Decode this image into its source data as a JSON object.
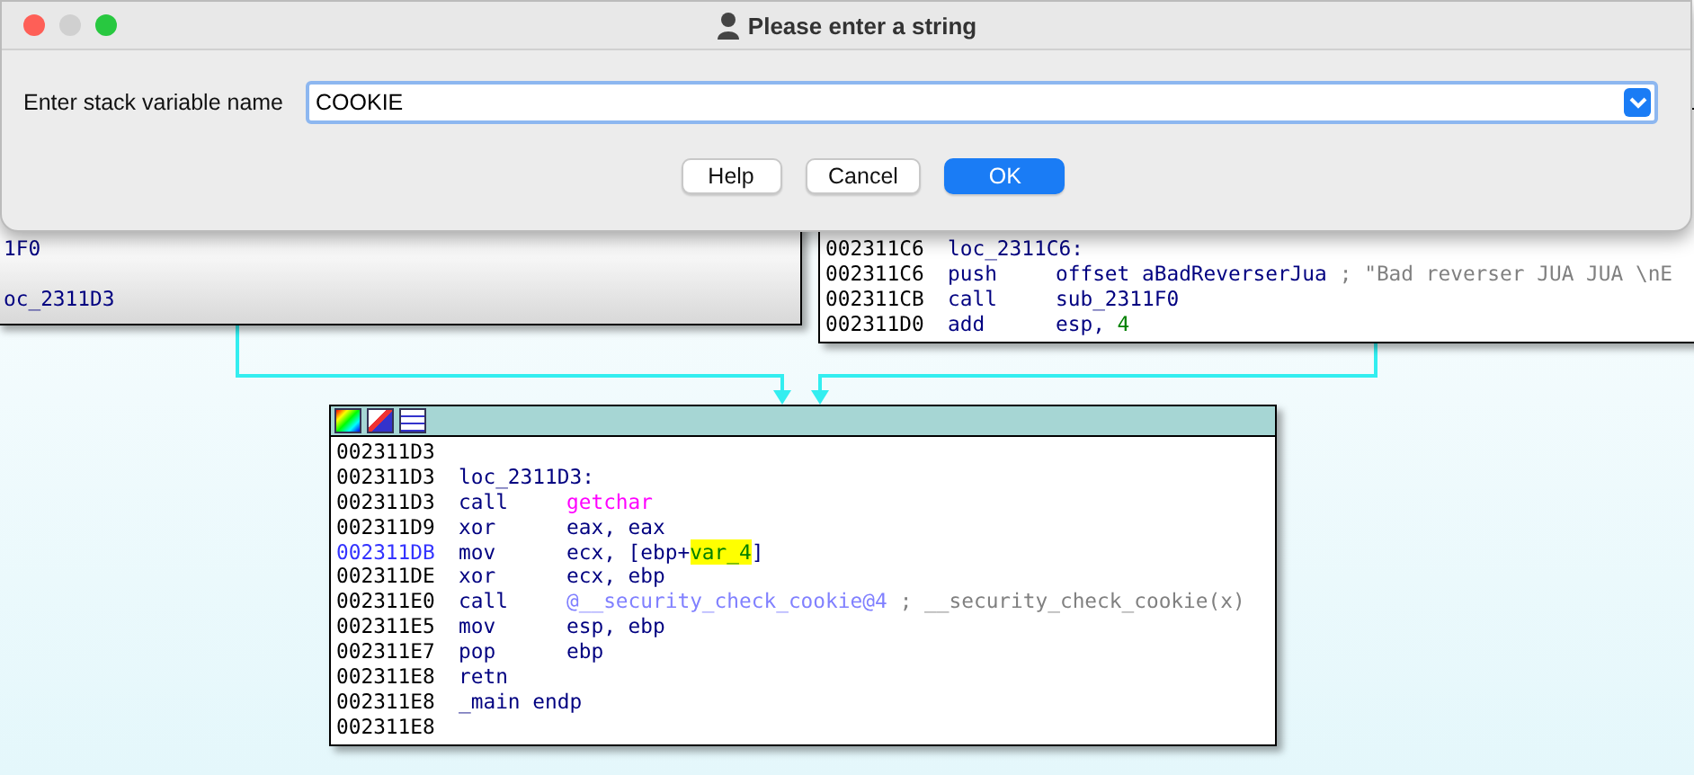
{
  "dialog": {
    "title": "Please enter a string",
    "field_label": "Enter stack variable name",
    "field_value": "COOKIE",
    "buttons": [
      {
        "label": "Help",
        "kind": "plain"
      },
      {
        "label": "Cancel",
        "kind": "plain"
      },
      {
        "label": "OK",
        "kind": "default"
      }
    ]
  },
  "graph": {
    "nodes": [
      {
        "kind": "partial-left",
        "header": false,
        "lines": [
          {
            "kind": "code",
            "operands": [
              {
                "text": "1F0",
                "kind": "plain"
              }
            ]
          },
          {
            "kind": "blank"
          },
          {
            "kind": "code",
            "operands": [
              {
                "text": "oc_2311D3",
                "kind": "plain"
              }
            ]
          }
        ]
      },
      {
        "kind": "partial-right",
        "header": false,
        "lines": [
          {
            "address": "002311C6",
            "selected": false,
            "label": "loc_2311C6:"
          },
          {
            "address": "002311C6",
            "selected": false,
            "mnemonic": "push",
            "operands": [
              {
                "text": "offset aBadReverserJua",
                "kind": "plain"
              }
            ],
            "comment": "; \"Bad reverser JUA JUA \\nE"
          },
          {
            "address": "002311CB",
            "selected": false,
            "mnemonic": "call",
            "operands": [
              {
                "text": "sub_2311F0",
                "kind": "plain"
              }
            ]
          },
          {
            "address": "002311D0",
            "selected": false,
            "mnemonic": "add",
            "operands": [
              {
                "text": "esp, ",
                "kind": "plain"
              },
              {
                "text": "4",
                "kind": "num"
              }
            ]
          }
        ]
      },
      {
        "kind": "full",
        "header": true,
        "lines": [
          {
            "address": "002311D3",
            "selected": false
          },
          {
            "address": "002311D3",
            "selected": false,
            "label": "loc_2311D3:"
          },
          {
            "address": "002311D3",
            "selected": false,
            "mnemonic": "call",
            "operands": [
              {
                "text": "getchar",
                "kind": "func"
              }
            ]
          },
          {
            "address": "002311D9",
            "selected": false,
            "mnemonic": "xor",
            "operands": [
              {
                "text": "eax, eax",
                "kind": "plain"
              }
            ]
          },
          {
            "address": "002311DB",
            "selected": true,
            "mnemonic": "mov",
            "operands": [
              {
                "text": "ecx, [ebp+",
                "kind": "plain"
              },
              {
                "text": "var_4",
                "kind": "var"
              },
              {
                "text": "]",
                "kind": "plain"
              }
            ]
          },
          {
            "address": "002311DE",
            "selected": false,
            "mnemonic": "xor",
            "operands": [
              {
                "text": "ecx, ebp",
                "kind": "plain"
              }
            ]
          },
          {
            "address": "002311E0",
            "selected": false,
            "mnemonic": "call",
            "operands": [
              {
                "text": "@__security_check_cookie@4",
                "kind": "import"
              }
            ],
            "comment": "; __security_check_cookie(x)"
          },
          {
            "address": "002311E5",
            "selected": false,
            "mnemonic": "mov",
            "operands": [
              {
                "text": "esp, ebp",
                "kind": "plain"
              }
            ]
          },
          {
            "address": "002311E7",
            "selected": false,
            "mnemonic": "pop",
            "operands": [
              {
                "text": "ebp",
                "kind": "plain"
              }
            ]
          },
          {
            "address": "002311E8",
            "selected": false,
            "mnemonic": "retn"
          },
          {
            "address": "002311E8",
            "selected": false,
            "label": "_main endp"
          },
          {
            "address": "002311E8",
            "selected": false
          }
        ]
      }
    ]
  }
}
